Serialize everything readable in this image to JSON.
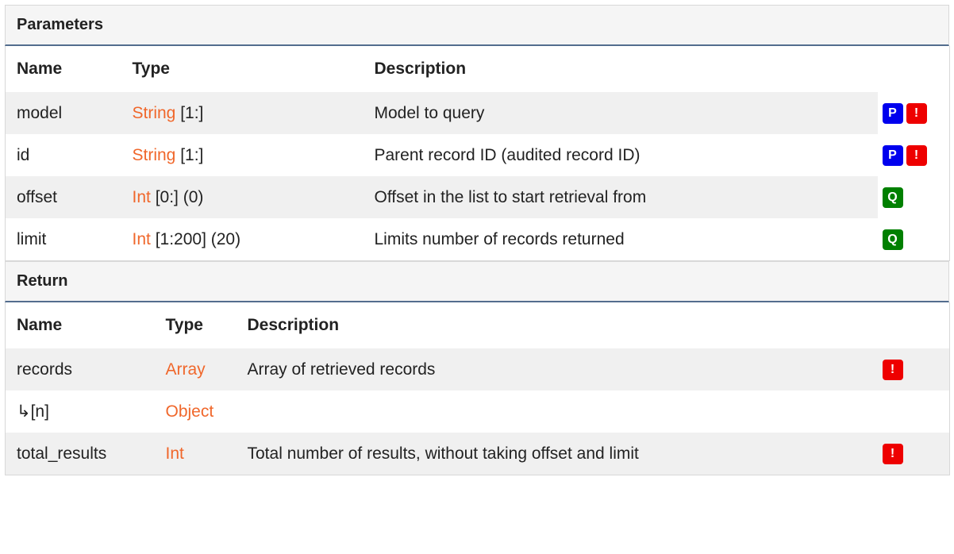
{
  "parameters": {
    "title": "Parameters",
    "columns": [
      "Name",
      "Type",
      "Description"
    ],
    "rows": [
      {
        "name": "model",
        "type_name": "String",
        "type_rest": " [1:]",
        "description": "Model to query",
        "badges": [
          "P",
          "!"
        ]
      },
      {
        "name": "id",
        "type_name": "String",
        "type_rest": " [1:]",
        "description": "Parent record ID (audited record ID)",
        "badges": [
          "P",
          "!"
        ]
      },
      {
        "name": "offset",
        "type_name": "Int",
        "type_rest": " [0:] (0)",
        "description": "Offset in the list to start retrieval from",
        "badges": [
          "Q"
        ]
      },
      {
        "name": "limit",
        "type_name": "Int",
        "type_rest": " [1:200] (20)",
        "description": "Limits number of records returned",
        "badges": [
          "Q"
        ]
      }
    ]
  },
  "return": {
    "title": "Return",
    "columns": [
      "Name",
      "Type",
      "Description"
    ],
    "rows": [
      {
        "name": "records",
        "type_name": "Array",
        "type_rest": "",
        "description": "Array of retrieved records",
        "badges": [
          "!"
        ]
      },
      {
        "name": "↳[n]",
        "type_name": "Object",
        "type_rest": "",
        "description": "",
        "badges": []
      },
      {
        "name": "total_results",
        "type_name": "Int",
        "type_rest": "",
        "description": "Total number of results, without taking offset and limit",
        "badges": [
          "!"
        ]
      }
    ]
  },
  "badge_colors": {
    "P": "#0000ee",
    "!": "#ee0000",
    "Q": "#008000"
  },
  "type_color": "#f0672b"
}
